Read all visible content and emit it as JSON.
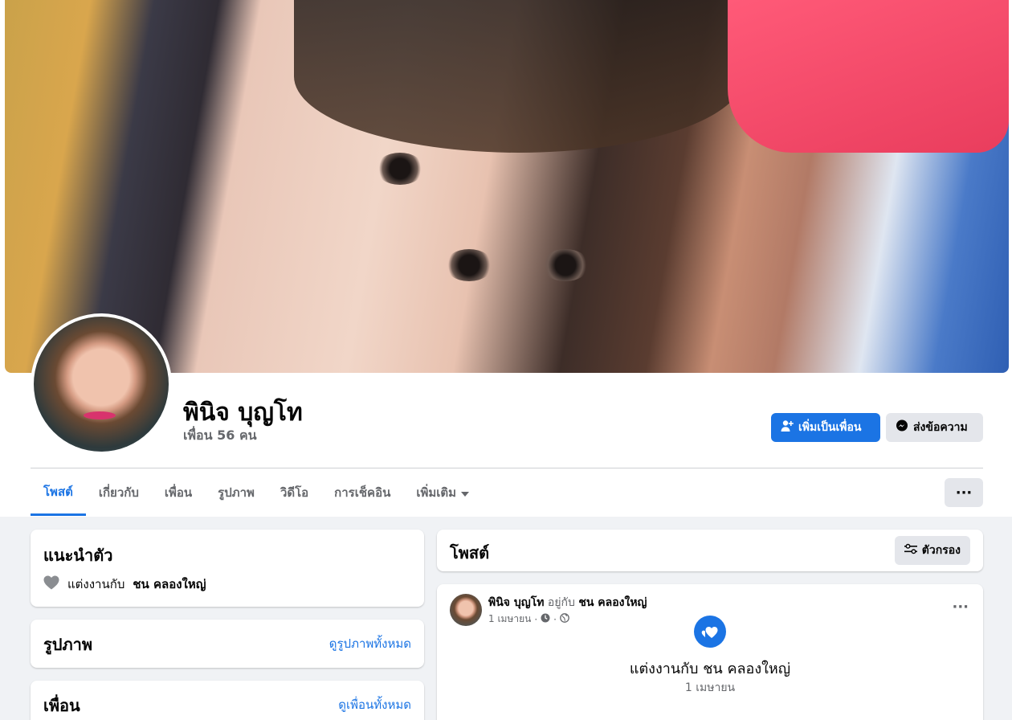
{
  "profile": {
    "name": "พินิจ บุญโท",
    "friends": "เพื่อน 56 คน"
  },
  "actions": {
    "add_friend": "เพิ่มเป็นเพื่อน",
    "message": "ส่งข้อความ",
    "more_dots": "···"
  },
  "tabs": [
    {
      "label": "โพสต์"
    },
    {
      "label": "เกี่ยวกับ"
    },
    {
      "label": "เพื่อน"
    },
    {
      "label": "รูปภาพ"
    },
    {
      "label": "วิดีโอ"
    },
    {
      "label": "การเช็คอิน"
    },
    {
      "label": "เพิ่มเติม"
    }
  ],
  "intro": {
    "title": "แนะนำตัว",
    "relationship_prefix": "แต่งงานกับ",
    "relationship_name": "ชน คลองใหญ่"
  },
  "photos": {
    "title": "รูปภาพ",
    "see_all": "ดูรูปภาพทั้งหมด"
  },
  "friends_card": {
    "title": "เพื่อน",
    "see_all": "ดูเพื่อนทั้งหมด"
  },
  "posts_header": {
    "title": "โพสต์",
    "filter": "ตัวกรอง"
  },
  "post": {
    "author": "พินิจ บุญโท",
    "with_text": "อยู่กับ",
    "with_name": "ชน คลองใหญ่",
    "date": "1 เมษายน",
    "dots": "···",
    "event_title": "แต่งงานกับ ชน คลองใหญ่",
    "event_date": "1 เมษายน"
  },
  "colors": {
    "accent": "#1b74e4",
    "background": "#f0f2f5",
    "secondary_text": "#65676b"
  }
}
